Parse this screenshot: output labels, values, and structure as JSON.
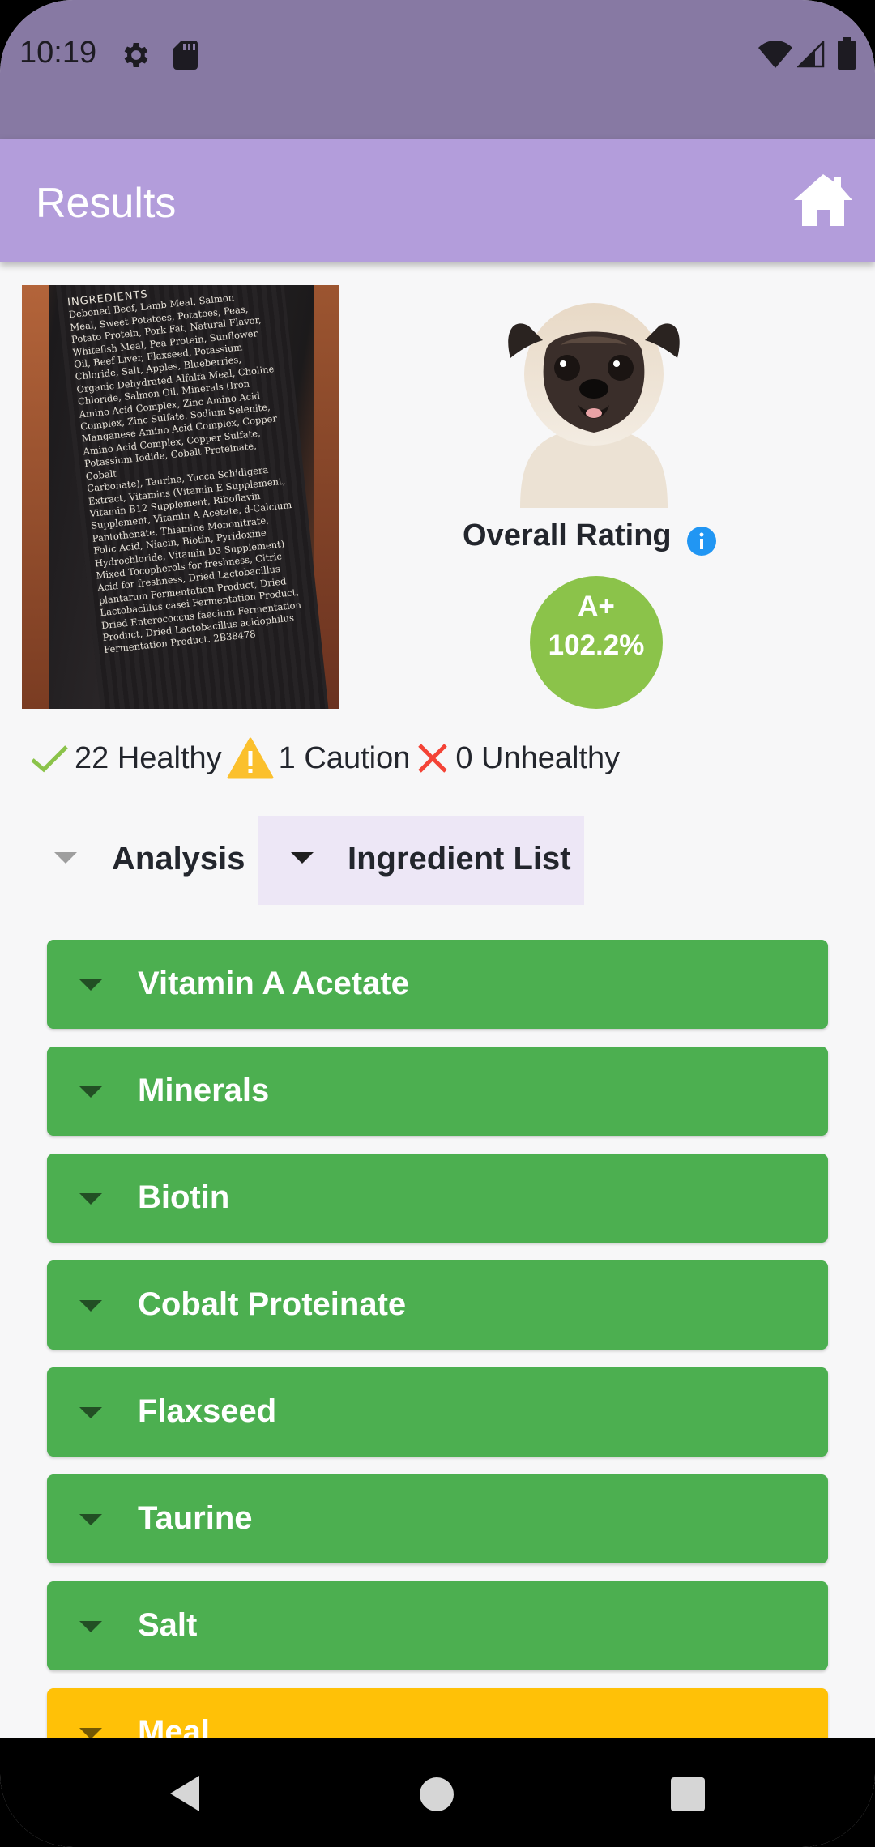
{
  "status_bar": {
    "time": "10:19",
    "icons": [
      "gear-icon",
      "sd-card-icon",
      "wifi-icon",
      "signal-icon",
      "battery-icon"
    ]
  },
  "app_bar": {
    "title": "Results",
    "home_icon": "home-icon"
  },
  "product_label": {
    "heading": "INGREDIENTS",
    "lines": [
      "Deboned Beef, Lamb Meal, Salmon",
      "Meal, Sweet Potatoes, Potatoes, Peas,",
      "Potato Protein, Pork Fat, Natural Flavor,",
      "Whitefish Meal, Pea Protein, Sunflower",
      "Oil, Beef Liver, Flaxseed, Potassium",
      "Chloride, Salt, Apples, Blueberries,",
      "Organic Dehydrated Alfalfa Meal, Choline",
      "Chloride, Salmon Oil, Minerals (Iron",
      "Amino Acid Complex, Zinc Amino Acid",
      "Complex, Zinc Sulfate, Sodium Selenite,",
      "Manganese Amino Acid Complex, Copper",
      "Amino Acid Complex, Copper Sulfate,",
      "Potassium Iodide, Cobalt Proteinate, Cobalt",
      "Carbonate), Taurine, Yucca Schidigera",
      "Extract, Vitamins (Vitamin E Supplement,",
      "Vitamin B12 Supplement, Riboflavin",
      "Supplement, Vitamin A Acetate, d-Calcium",
      "Pantothenate, Thiamine Mononitrate,",
      "Folic Acid, Niacin, Biotin, Pyridoxine",
      "Hydrochloride, Vitamin D3 Supplement)",
      "Mixed Tocopherols for freshness, Citric",
      "Acid for freshness, Dried Lactobacillus",
      "plantarum Fermentation Product, Dried",
      "Lactobacillus casei Fermentation Product,",
      "Dried Enterococcus faecium Fermentation",
      "Product, Dried Lactobacillus acidophilus",
      "Fermentation Product.   2B38478"
    ]
  },
  "rating": {
    "label": "Overall Rating",
    "grade": "A+",
    "percent": "102.2%",
    "color": "#8bc34a"
  },
  "summary": {
    "healthy": "22 Healthy",
    "caution": "1 Caution",
    "unhealthy": "0 Unhealthy"
  },
  "tabs": [
    {
      "label": "Analysis",
      "active": false
    },
    {
      "label": "Ingredient List",
      "active": true
    }
  ],
  "ingredients": [
    {
      "name": "Vitamin A Acetate",
      "status": "healthy",
      "color": "#4caf50"
    },
    {
      "name": "Minerals",
      "status": "healthy",
      "color": "#4caf50"
    },
    {
      "name": "Biotin",
      "status": "healthy",
      "color": "#4caf50"
    },
    {
      "name": "Cobalt Proteinate",
      "status": "healthy",
      "color": "#4caf50"
    },
    {
      "name": "Flaxseed",
      "status": "healthy",
      "color": "#4caf50"
    },
    {
      "name": "Taurine",
      "status": "healthy",
      "color": "#4caf50"
    },
    {
      "name": "Salt",
      "status": "healthy",
      "color": "#4caf50"
    },
    {
      "name": "Meal",
      "status": "caution",
      "color": "#ffc107"
    }
  ],
  "nav_bar": {
    "icons": [
      "back-icon",
      "home-icon",
      "recents-icon"
    ]
  }
}
